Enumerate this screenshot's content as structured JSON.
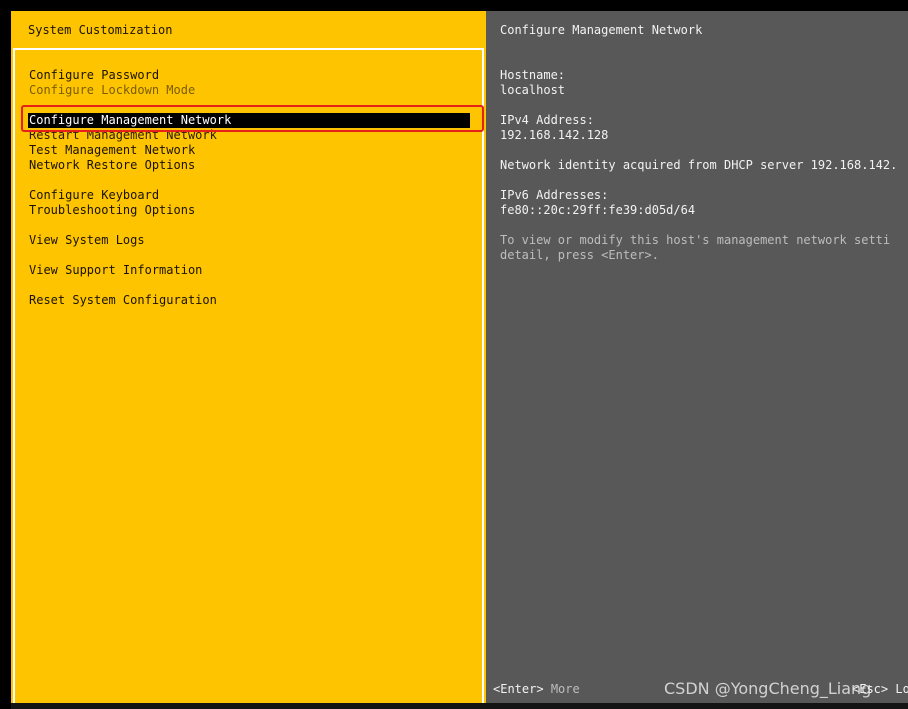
{
  "left_panel": {
    "title": "System Customization",
    "menu": [
      {
        "label": "Configure Password",
        "state": "normal"
      },
      {
        "label": "Configure Lockdown Mode",
        "state": "dim"
      },
      {
        "label": "Configure Management Network",
        "state": "selected"
      },
      {
        "label": "Restart Management Network",
        "state": "normal"
      },
      {
        "label": "Test Management Network",
        "state": "normal"
      },
      {
        "label": "Network Restore Options",
        "state": "normal"
      },
      {
        "label": "Configure Keyboard",
        "state": "normal"
      },
      {
        "label": "Troubleshooting Options",
        "state": "normal"
      },
      {
        "label": "View System Logs",
        "state": "normal"
      },
      {
        "label": "View Support Information",
        "state": "normal"
      },
      {
        "label": "Reset System Configuration",
        "state": "normal"
      }
    ]
  },
  "right_panel": {
    "title": "Configure Management Network",
    "hostname_label": "Hostname:",
    "hostname_value": "localhost",
    "ipv4_label": "IPv4 Address:",
    "ipv4_value": "192.168.142.128",
    "dhcp_text": "Network identity acquired from DHCP server 192.168.142.",
    "ipv6_label": "IPv6 Addresses:",
    "ipv6_value": "fe80::20c:29ff:fe39:d05d/64",
    "help_line1": "To view or modify this host's management network setti",
    "help_line2": "detail, press <Enter>."
  },
  "footer": {
    "enter_key": "<Enter>",
    "enter_action": "More",
    "esc_key": "<Esc>",
    "esc_action": "Lo"
  },
  "watermark": "CSDN @YongCheng_Liang",
  "colors": {
    "left_bg": "#ffc400",
    "right_bg": "#585858",
    "selection_bg": "#000000",
    "annotation_box": "#e8201a"
  }
}
